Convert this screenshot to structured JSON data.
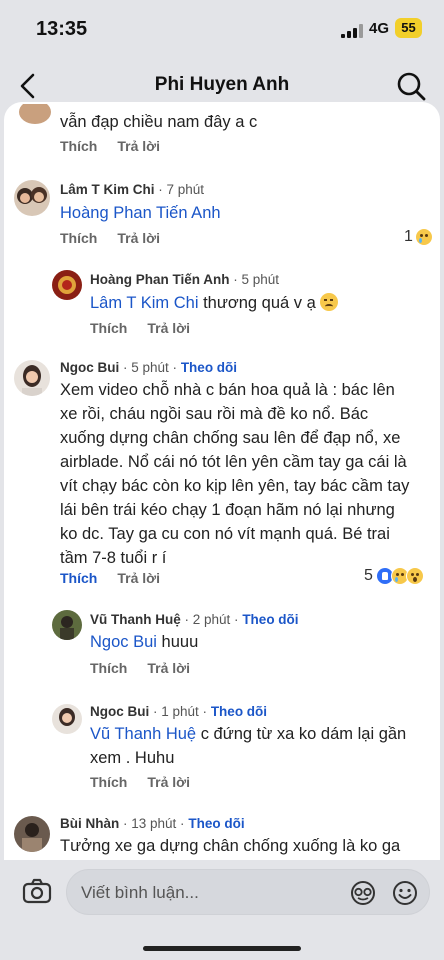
{
  "status_bar": {
    "time": "13:35",
    "network": "4G",
    "battery": "55"
  },
  "header": {
    "title": "Phi Huyen Anh"
  },
  "comments": [
    {
      "text_tail": "vẫn đạp chiều nam đây a c",
      "actions": {
        "like": "Thích",
        "reply": "Trả lời"
      }
    },
    {
      "author": "Lâm T Kim Chi",
      "time": "· 7 phút",
      "mention": "Hoàng Phan Tiến Anh",
      "text": "",
      "actions": {
        "like": "Thích",
        "reply": "Trả lời"
      },
      "reaction_count": "1"
    },
    {
      "author": "Hoàng Phan Tiến Anh",
      "time": "· 5 phút",
      "mention": "Lâm T Kim Chi",
      "text": " thương quá v ạ",
      "actions": {
        "like": "Thích",
        "reply": "Trả lời"
      }
    },
    {
      "author": "Ngoc Bui",
      "time": "· 5 phút ·",
      "follow": "Theo dõi",
      "lines": [
        "Xem video chỗ nhà c bán hoa quả là : bác lên",
        "xe rồi, cháu ngồi sau rồi mà đề ko nổ. Bác",
        "xuống dựng chân chống sau lên để đạp nổ, xe",
        "airblade. Nổ cái nó tót lên yên cầm tay ga cái là",
        "vít chạy bác còn ko kịp lên yên, tay bác cầm tay",
        "lái bên trái kéo chạy 1 đoạn hãm nó lại nhưng",
        "ko dc. Tay ga cu con nó vít mạnh quá. Bé trai",
        "tầm 7-8 tuổi r í"
      ],
      "actions": {
        "like": "Thích",
        "reply": "Trả lời"
      },
      "reaction_count": "5"
    },
    {
      "author": "Vũ Thanh Huệ",
      "time": "· 2 phút ·",
      "follow": "Theo dõi",
      "mention": "Ngoc Bui",
      "text": " huuu",
      "actions": {
        "like": "Thích",
        "reply": "Trả lời"
      }
    },
    {
      "author": "Ngoc Bui",
      "time": "· 1 phút ·",
      "follow": "Theo dõi",
      "mention": "Vũ Thanh Huệ",
      "text": " c đứng từ xa ko dám lại gần",
      "line2": "xem . Huhu",
      "actions": {
        "like": "Thích",
        "reply": "Trả lời"
      }
    },
    {
      "author": "Bùi Nhàn",
      "time": "· 13 phút ·",
      "follow": "Theo dõi",
      "text": "Tưởng xe ga dựng chân chống xuống là ko ga"
    }
  ],
  "composer": {
    "placeholder": "Viết bình luận..."
  },
  "colors": {
    "link_blue": "#1b56c8",
    "background": "#e3e4e8",
    "battery": "#f2cf2a"
  }
}
